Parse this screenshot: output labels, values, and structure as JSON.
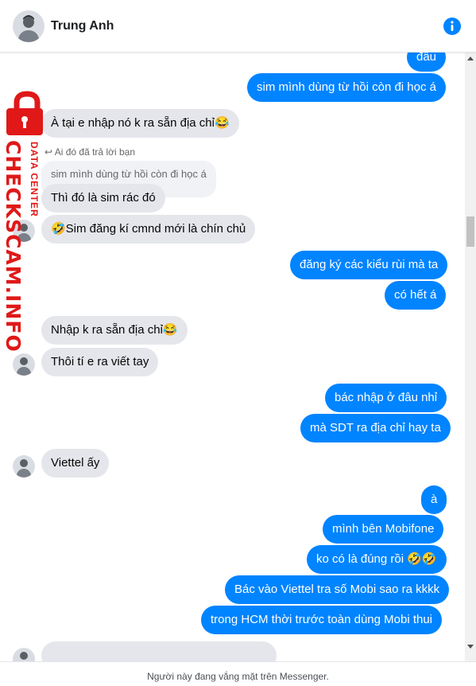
{
  "header": {
    "contact_name": "Trung Anh",
    "avatar_icon": "user-avatar",
    "info_icon": "info-icon"
  },
  "watermark": {
    "brand": "CHECKSCAM.INFO",
    "tagline": "DATA CENTER",
    "icon": "lock-icon",
    "color": "#e01818"
  },
  "colors": {
    "outgoing_bubble": "#0084ff",
    "incoming_bubble": "#e4e6eb",
    "accent": "#0084ff"
  },
  "messages": [
    {
      "dir": "out",
      "text": "đâu"
    },
    {
      "dir": "out",
      "text": "sim mình dùng từ hồi còn đi học á"
    },
    {
      "dir": "in",
      "text": "À tại e nhập nó k ra sẵn địa chỉ😂"
    },
    {
      "dir": "in",
      "reply_note": "Ai đó đã trả lời bạn",
      "reply_quote": "sim mình dùng từ hồi còn đi học á",
      "text": "Thì đó là sim rác đó"
    },
    {
      "dir": "in",
      "text": "🤣Sim đăng kí cmnd mới là chín chủ"
    },
    {
      "dir": "out",
      "text": "đăng ký các kiểu rùi mà ta"
    },
    {
      "dir": "out",
      "text": "có hết á"
    },
    {
      "dir": "in",
      "text": "Nhập k ra sẵn địa chỉ😂"
    },
    {
      "dir": "in",
      "text": "Thôi tí e ra viết tay"
    },
    {
      "dir": "out",
      "text": "bác nhập ở đâu nhỉ"
    },
    {
      "dir": "out",
      "text": "mà SDT ra địa chỉ hay ta"
    },
    {
      "dir": "in",
      "text": "Viettel ấy"
    },
    {
      "dir": "out",
      "text": "à"
    },
    {
      "dir": "out",
      "text": "mình bên Mobifone"
    },
    {
      "dir": "out",
      "text": "ko có là đúng rồi 🤣🤣"
    },
    {
      "dir": "out",
      "text": "Bác vào Viettel tra số Mobi sao ra kkkk"
    },
    {
      "dir": "out",
      "text": "trong HCM thời trước toàn dùng Mobi thui"
    }
  ],
  "footer": {
    "status_text": "Người này đang vắng mặt trên Messenger."
  }
}
